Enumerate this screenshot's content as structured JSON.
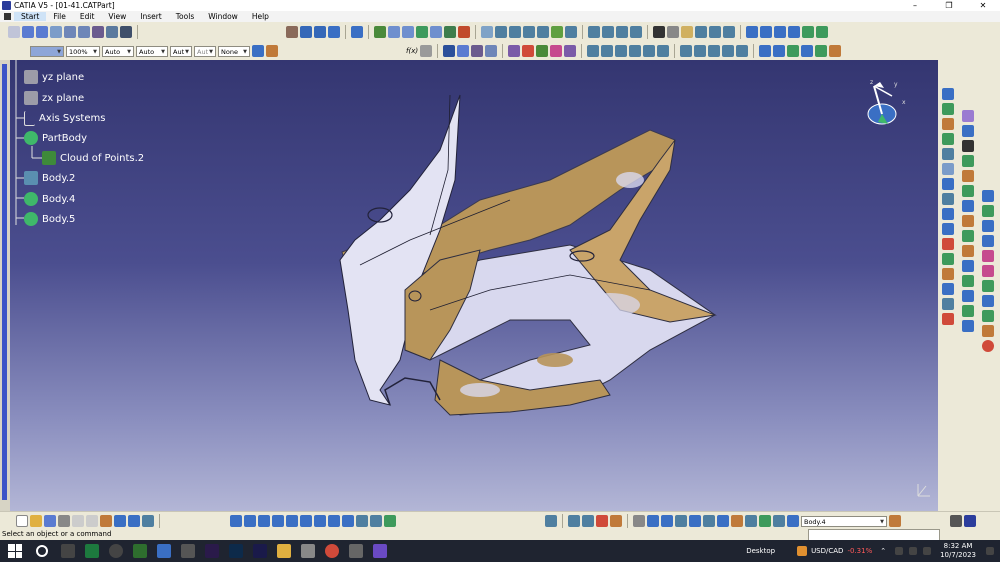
{
  "window": {
    "title": "CATIA V5 - [01-41.CATPart]"
  },
  "menu": {
    "items": [
      "Start",
      "File",
      "Edit",
      "View",
      "Insert",
      "Tools",
      "Window",
      "Help"
    ]
  },
  "toolbar": {
    "combos": {
      "color": "",
      "zoom": "100%",
      "linetype": "Auto",
      "linewidth": "Auto",
      "layer": "Aut",
      "point": "Aut",
      "render": "None"
    },
    "fx_label": "f(x)"
  },
  "tree": {
    "items": [
      {
        "label": "yz plane"
      },
      {
        "label": "zx plane"
      },
      {
        "label": "Axis Systems"
      },
      {
        "label": "PartBody"
      },
      {
        "label": "Cloud of Points.2"
      },
      {
        "label": "Body.2"
      },
      {
        "label": "Body.4"
      },
      {
        "label": "Body.5"
      }
    ]
  },
  "bottom_toolbar": {
    "body_select": "Body.4"
  },
  "status": {
    "message": "Select an object or a command"
  },
  "compass": {
    "x": "x",
    "y": "y",
    "z": "z"
  },
  "taskbar": {
    "desktop_label": "Desktop",
    "ticker": "USD/CAD",
    "ticker_change": "-0.31%",
    "time": "8:32 AM",
    "date": "10/7/2023"
  },
  "colors": {
    "accent": "#2b3d9c",
    "viewport_top": "#343671",
    "viewport_bottom": "#b3b6d6",
    "model_tan": "#b8955a",
    "model_white": "#d8d8ee",
    "ticker_down": "#ff5a5a"
  },
  "icons": [
    "catia-logo",
    "close-icon",
    "maximize-icon",
    "minimize-icon",
    "compass-icon",
    "windows-start-icon",
    "search-icon"
  ]
}
